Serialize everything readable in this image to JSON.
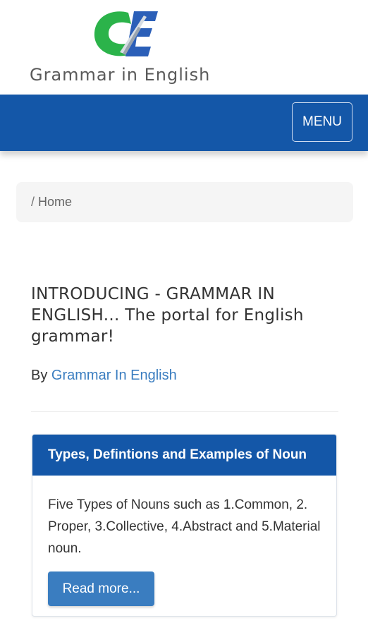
{
  "site": {
    "logo_text": "Grammar in English"
  },
  "nav": {
    "menu_label": "MENU"
  },
  "breadcrumb": {
    "separator": "/",
    "home": "Home"
  },
  "article": {
    "title": "INTRODUCING - GRAMMAR IN ENGLISH... The portal for English grammar!",
    "by_label": "By",
    "author": "Grammar In English"
  },
  "card": {
    "title": "Types, Defintions and Examples of Noun",
    "body": "Five Types of Nouns such as 1.Common, 2. Proper, 3.Collective, 4.Abstract and 5.Material noun.",
    "button": "Read more..."
  },
  "colors": {
    "brand_blue": "#1457a8",
    "link_blue": "#3a7dc0",
    "logo_green": "#2bb34a",
    "logo_blue": "#2b5fb8"
  },
  "icons": {
    "logo": "ge-logo-icon"
  }
}
